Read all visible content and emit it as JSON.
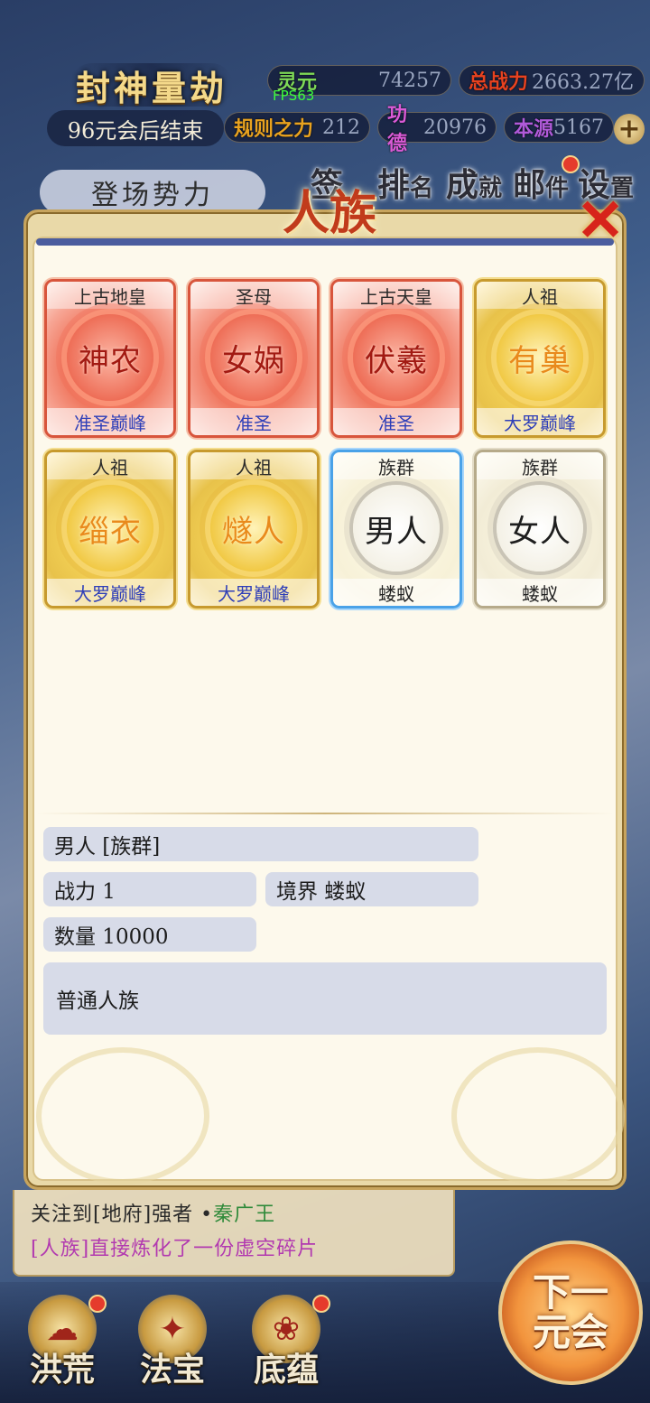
{
  "hud": {
    "title": "封神量劫",
    "subtitle": "96元会后结束",
    "fps": "FPS63",
    "stats": {
      "lingyuan": {
        "label": "灵元",
        "value": "74257"
      },
      "total_power": {
        "label": "总战力",
        "value": "2663.27亿"
      },
      "rule_power": {
        "label": "规则之力",
        "value": "212"
      },
      "merit": {
        "label": "功德",
        "value": "20976"
      },
      "origin": {
        "label": "本源",
        "value": "5167"
      }
    },
    "plus": "+",
    "faction_button": "登场势力",
    "top_nav": [
      {
        "label": "签",
        "sub": ""
      },
      {
        "label": "排",
        "sub": "名"
      },
      {
        "label": "成",
        "sub": "就"
      },
      {
        "label": "邮",
        "sub": "件"
      },
      {
        "label": "设",
        "sub": "置"
      }
    ]
  },
  "modal": {
    "title": "人族",
    "close": "✕",
    "cards": [
      {
        "top": "上古地皇",
        "name": "神农",
        "realm": "准圣巅峰",
        "style": "red"
      },
      {
        "top": "圣母",
        "name": "女娲",
        "realm": "准圣",
        "style": "red"
      },
      {
        "top": "上古天皇",
        "name": "伏羲",
        "realm": "准圣",
        "style": "red"
      },
      {
        "top": "人祖",
        "name": "有巢",
        "realm": "大罗巅峰",
        "style": "gold"
      },
      {
        "top": "人祖",
        "name": "缁衣",
        "realm": "大罗巅峰",
        "style": "gold"
      },
      {
        "top": "人祖",
        "name": "燧人",
        "realm": "大罗巅峰",
        "style": "gold"
      },
      {
        "top": "族群",
        "name": "男人",
        "realm": "蝼蚁",
        "style": "blue"
      },
      {
        "top": "族群",
        "name": "女人",
        "realm": "蝼蚁",
        "style": "plain"
      }
    ],
    "detail": {
      "name": "男人 [族群]",
      "power": "战力 1",
      "realm": "境界 蝼蚁",
      "count": "数量 10000",
      "description": "普通人族"
    }
  },
  "log": [
    {
      "prefix": "关注到[地府]强者 • ",
      "highlight": "秦广王"
    },
    {
      "prefix": "[人族]直接炼化了一份虚空碎片",
      "highlight": ""
    }
  ],
  "bottom_nav": [
    {
      "label": "洪荒",
      "icon": "☁"
    },
    {
      "label": "法宝",
      "icon": "✦"
    },
    {
      "label": "底蕴",
      "icon": "❀"
    }
  ],
  "next_button": "下一\n元会",
  "colors": {
    "modal_title": "#c13b1b",
    "realm_text": "#2f3fb8",
    "close": "#d7231b"
  }
}
